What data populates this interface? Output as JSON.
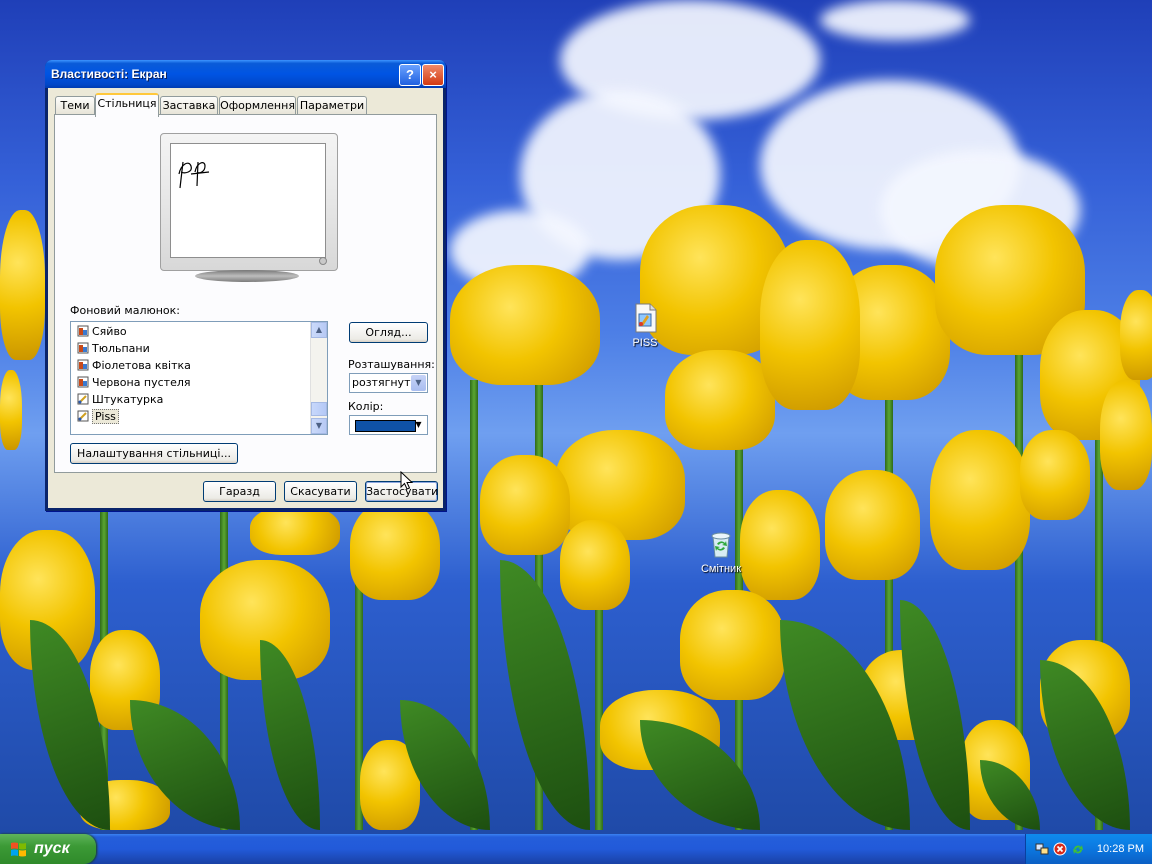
{
  "desktop": {
    "icons": [
      {
        "label": "PISS",
        "icon": "image-file-icon"
      },
      {
        "label": "Смітник",
        "icon": "recycle-bin-icon"
      }
    ]
  },
  "dialog": {
    "title": "Властивості: Екран",
    "help_button": "?",
    "close_button": "×",
    "tabs": [
      {
        "label": "Теми",
        "active": false
      },
      {
        "label": "Стільниця",
        "active": true
      },
      {
        "label": "Заставка",
        "active": false
      },
      {
        "label": "Оформлення",
        "active": false
      },
      {
        "label": "Параметри",
        "active": false
      }
    ],
    "preview": {
      "handwriting": "Pf"
    },
    "background_label": "Фоновий малюнок:",
    "background_list": [
      {
        "label": "Сяйво",
        "icon": "bitmap-icon",
        "selected": false
      },
      {
        "label": "Тюльпани",
        "icon": "bitmap-icon",
        "selected": false
      },
      {
        "label": "Фіолетова квітка",
        "icon": "bitmap-icon",
        "selected": false
      },
      {
        "label": "Червона пустеля",
        "icon": "bitmap-icon",
        "selected": false
      },
      {
        "label": "Штукатурка",
        "icon": "paint-icon",
        "selected": false
      },
      {
        "label": "Piss",
        "icon": "paint-icon",
        "selected": true
      }
    ],
    "browse_button": "Огляд...",
    "position_label": "Розташування:",
    "position_value": "розтягнути",
    "color_label": "Колір:",
    "color_value": "#0f52a6",
    "customize_button": "Налаштування стільниці...",
    "ok_button": "Гаразд",
    "cancel_button": "Скасувати",
    "apply_button": "Застосувати"
  },
  "taskbar": {
    "start_label": "пуск",
    "clock": "10:28 PM"
  }
}
